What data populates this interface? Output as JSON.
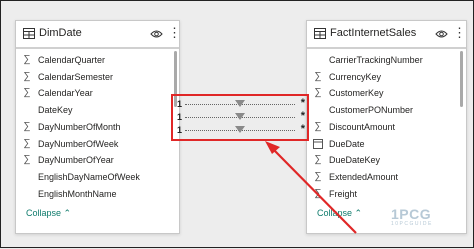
{
  "left_table": {
    "title": "DimDate",
    "fields": [
      {
        "icon": "sigma-icon",
        "glyph": "∑",
        "label": "CalendarQuarter"
      },
      {
        "icon": "sigma-icon",
        "glyph": "∑",
        "label": "CalendarSemester"
      },
      {
        "icon": "sigma-icon",
        "glyph": "∑",
        "label": "CalendarYear"
      },
      {
        "icon": "none",
        "glyph": "",
        "label": "DateKey"
      },
      {
        "icon": "sigma-icon",
        "glyph": "∑",
        "label": "DayNumberOfMonth"
      },
      {
        "icon": "sigma-icon",
        "glyph": "∑",
        "label": "DayNumberOfWeek"
      },
      {
        "icon": "sigma-icon",
        "glyph": "∑",
        "label": "DayNumberOfYear"
      },
      {
        "icon": "none",
        "glyph": "",
        "label": "EnglishDayNameOfWeek"
      },
      {
        "icon": "none",
        "glyph": "",
        "label": "EnglishMonthName"
      }
    ],
    "collapse_label": "Collapse"
  },
  "right_table": {
    "title": "FactInternetSales",
    "fields": [
      {
        "icon": "none",
        "glyph": "",
        "label": "CarrierTrackingNumber"
      },
      {
        "icon": "sigma-icon",
        "glyph": "∑",
        "label": "CurrencyKey"
      },
      {
        "icon": "sigma-icon",
        "glyph": "∑",
        "label": "CustomerKey"
      },
      {
        "icon": "none",
        "glyph": "",
        "label": "CustomerPONumber"
      },
      {
        "icon": "sigma-icon",
        "glyph": "∑",
        "label": "DiscountAmount"
      },
      {
        "icon": "calendar-icon",
        "glyph": "",
        "label": "DueDate"
      },
      {
        "icon": "sigma-icon",
        "glyph": "∑",
        "label": "DueDateKey"
      },
      {
        "icon": "sigma-icon",
        "glyph": "∑",
        "label": "ExtendedAmount"
      },
      {
        "icon": "sigma-icon",
        "glyph": "∑",
        "label": "Freight"
      }
    ],
    "collapse_label": "Collapse"
  },
  "relationships": [
    {
      "from": "1",
      "to": "*"
    },
    {
      "from": "1",
      "to": "*"
    },
    {
      "from": "1",
      "to": "*"
    }
  ],
  "watermark": {
    "logo": "1PCG",
    "sub": "10PCGUIDE"
  },
  "colors": {
    "highlight": "#e02727",
    "collapse": "#0f7b6c"
  }
}
